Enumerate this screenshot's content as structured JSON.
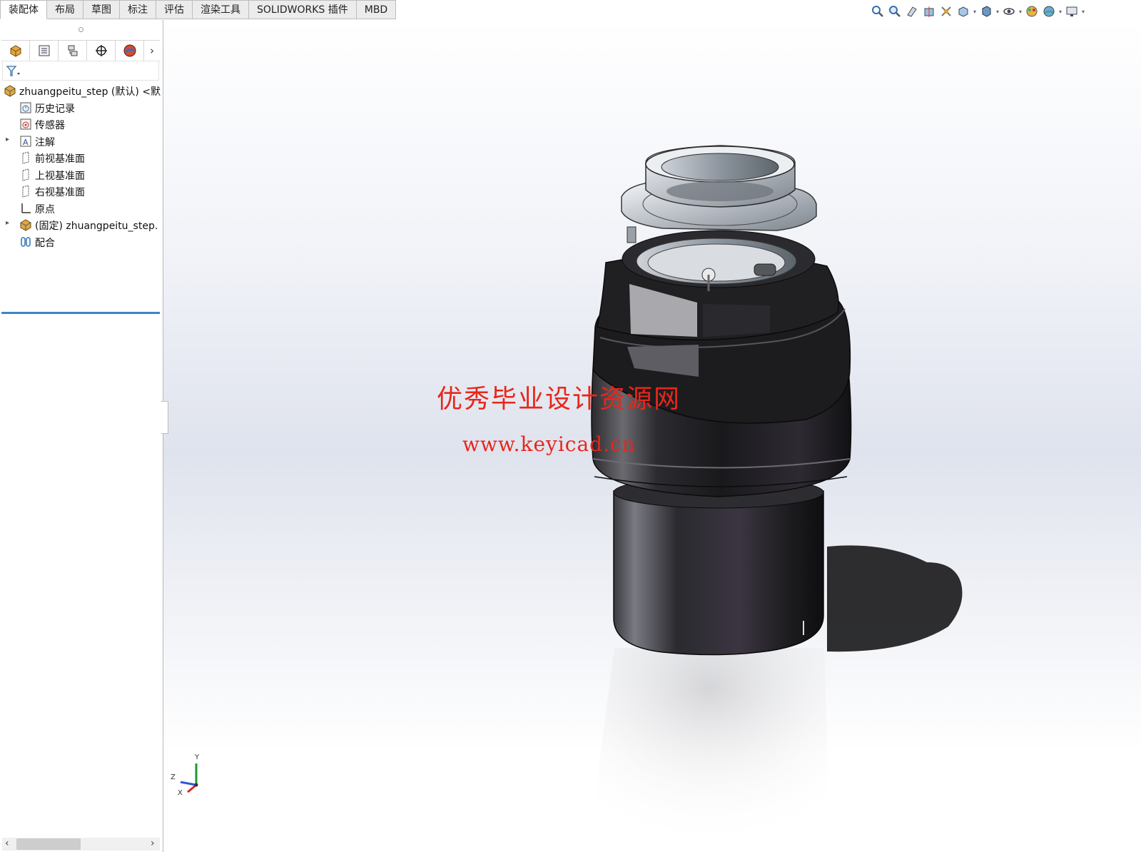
{
  "ribbon": {
    "tabs": [
      {
        "label": "装配体",
        "active": true
      },
      {
        "label": "布局"
      },
      {
        "label": "草图"
      },
      {
        "label": "标注"
      },
      {
        "label": "评估"
      },
      {
        "label": "渲染工具"
      },
      {
        "label": "SOLIDWORKS 插件"
      },
      {
        "label": "MBD"
      }
    ]
  },
  "view_toolbar": {
    "icons": [
      "zoom-to-fit-icon",
      "zoom-to-area-icon",
      "previous-view-icon",
      "section-view-icon",
      "dynamic-annotation-icon",
      "view-orientation-icon",
      "display-style-icon",
      "hide-show-items-icon",
      "edit-appearance-icon",
      "apply-scene-icon",
      "view-settings-icon"
    ]
  },
  "feature_manager": {
    "tabs": [
      "featuremanager-tree-icon",
      "propertymanager-icon",
      "configurationmanager-icon",
      "dimxpertmanager-icon",
      "displaymanager-icon"
    ],
    "tree": [
      {
        "label": "zhuangpeitu_step (默认) <默",
        "icon": "assembly-icon",
        "indent": 0,
        "expandable": false
      },
      {
        "label": "历史记录",
        "icon": "history-icon",
        "indent": 1,
        "expandable": false
      },
      {
        "label": "传感器",
        "icon": "sensor-icon",
        "indent": 1,
        "expandable": false
      },
      {
        "label": "注解",
        "icon": "annotation-icon",
        "indent": 1,
        "expandable": true
      },
      {
        "label": "前视基准面",
        "icon": "plane-icon",
        "indent": 1,
        "expandable": false
      },
      {
        "label": "上视基准面",
        "icon": "plane-icon",
        "indent": 1,
        "expandable": false
      },
      {
        "label": "右视基准面",
        "icon": "plane-icon",
        "indent": 1,
        "expandable": false
      },
      {
        "label": "原点",
        "icon": "origin-icon",
        "indent": 1,
        "expandable": false
      },
      {
        "label": "(固定) zhuangpeitu_step.",
        "icon": "subassembly-icon",
        "indent": 1,
        "expandable": true
      },
      {
        "label": "配合",
        "icon": "mates-icon",
        "indent": 1,
        "expandable": false
      }
    ]
  },
  "watermark": {
    "line1": "优秀毕业设计资源网",
    "line2": "www.keyicad.cn"
  },
  "triad": {
    "y": "Y",
    "z": "Z",
    "x": "X"
  },
  "colors": {
    "accent": "#3d86c6",
    "watermark": "#e8261a"
  }
}
